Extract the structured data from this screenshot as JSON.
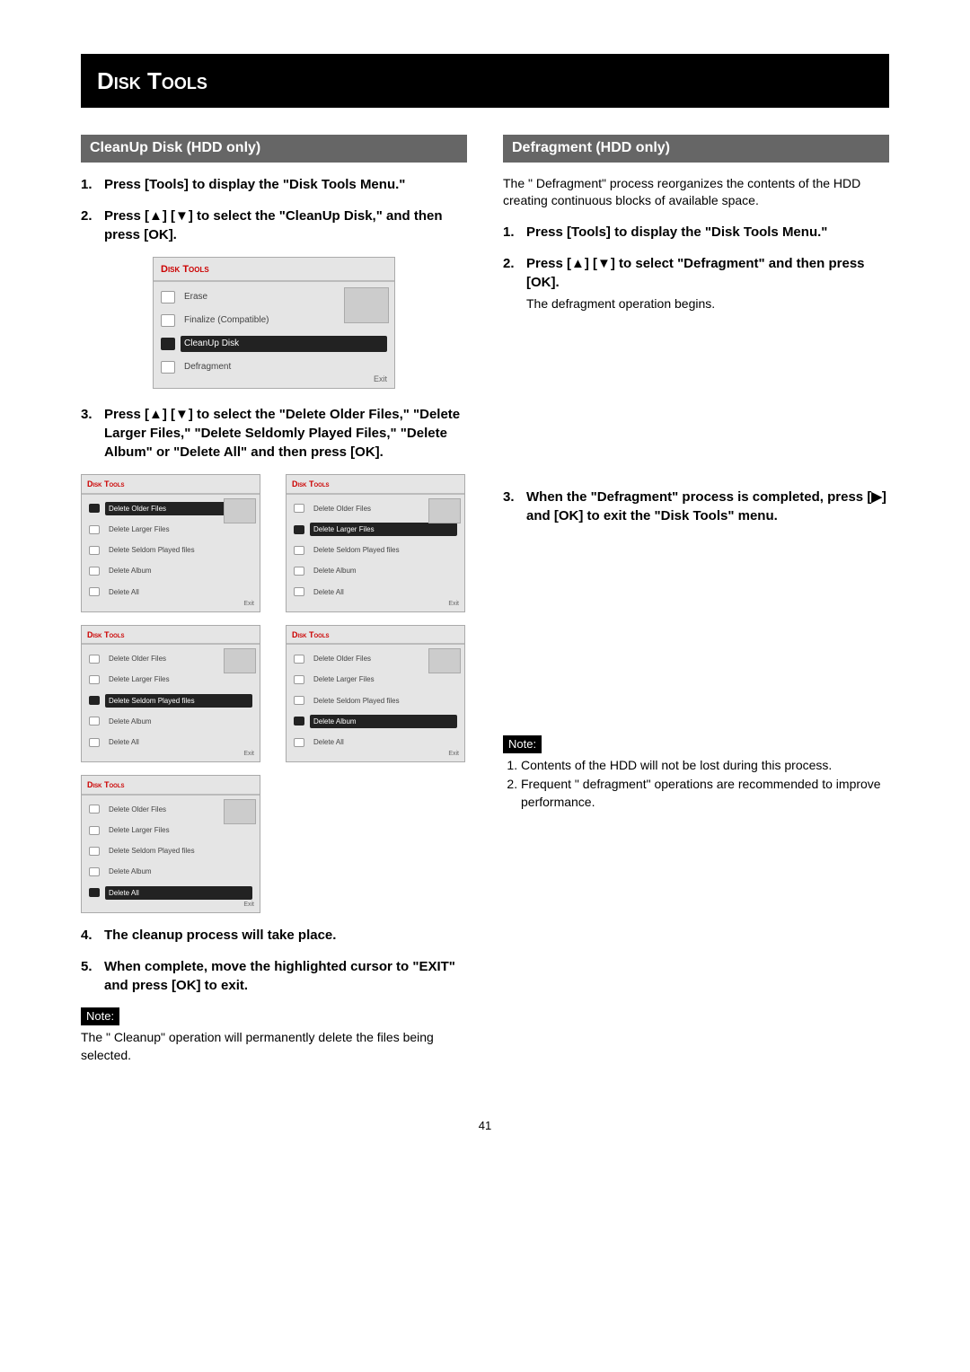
{
  "page_title": "Disk Tools",
  "page_number": "41",
  "left": {
    "header": "CleanUp Disk (HDD only)",
    "steps": {
      "s1": "Press [Tools] to display the \"Disk Tools Menu.\"",
      "s2": "Press [▲]  [▼] to select the \"CleanUp Disk,\" and then press [OK].",
      "s3": "Press [▲]  [▼] to select the \"Delete Older Files,\" \"Delete Larger Files,\" \"Delete Seldomly Played Files,\" \"Delete Album\" or \"Delete All\" and then press [OK].",
      "s4": "The cleanup process will take place.",
      "s5": "When complete, move the highlighted cursor to \"EXIT\" and press [OK] to exit."
    },
    "note_label": "Note:",
    "note_text": "The \" Cleanup\"  operation will permanently delete the files being selected."
  },
  "right": {
    "header": "Defragment  (HDD only)",
    "intro": "The \" Defragment\"  process reorganizes the contents of the HDD creating continuous blocks of available space.",
    "steps": {
      "s1": "Press [Tools] to display the \"Disk Tools Menu.\"",
      "s2": "Press [▲]  [▼] to select \"Defragment\" and then press [OK].",
      "s2_sub": "The defragment operation begins.",
      "s3": "When the \"Defragment\" process is completed, press [▶] and [OK] to exit the \"Disk Tools\" menu."
    },
    "note_label": "Note:",
    "notes": {
      "n1": "Contents of the HDD will not be lost during this process.",
      "n2": "Frequent \" defragment\"  operations are recommended to improve performance."
    }
  },
  "panel_main": {
    "title": "Disk Tools",
    "items": [
      "Erase",
      "Finalize (Compatible)",
      "CleanUp Disk",
      "Defragment"
    ],
    "selected_index": 2,
    "exit": "Exit"
  },
  "cleanup_options": {
    "title": "Disk Tools",
    "items": [
      "Delete Older Files",
      "Delete Larger Files",
      "Delete Seldom Played files",
      "Delete Album",
      "Delete All"
    ],
    "exit": "Exit"
  },
  "cleanup_panels_selected": [
    0,
    1,
    2,
    3,
    4
  ]
}
